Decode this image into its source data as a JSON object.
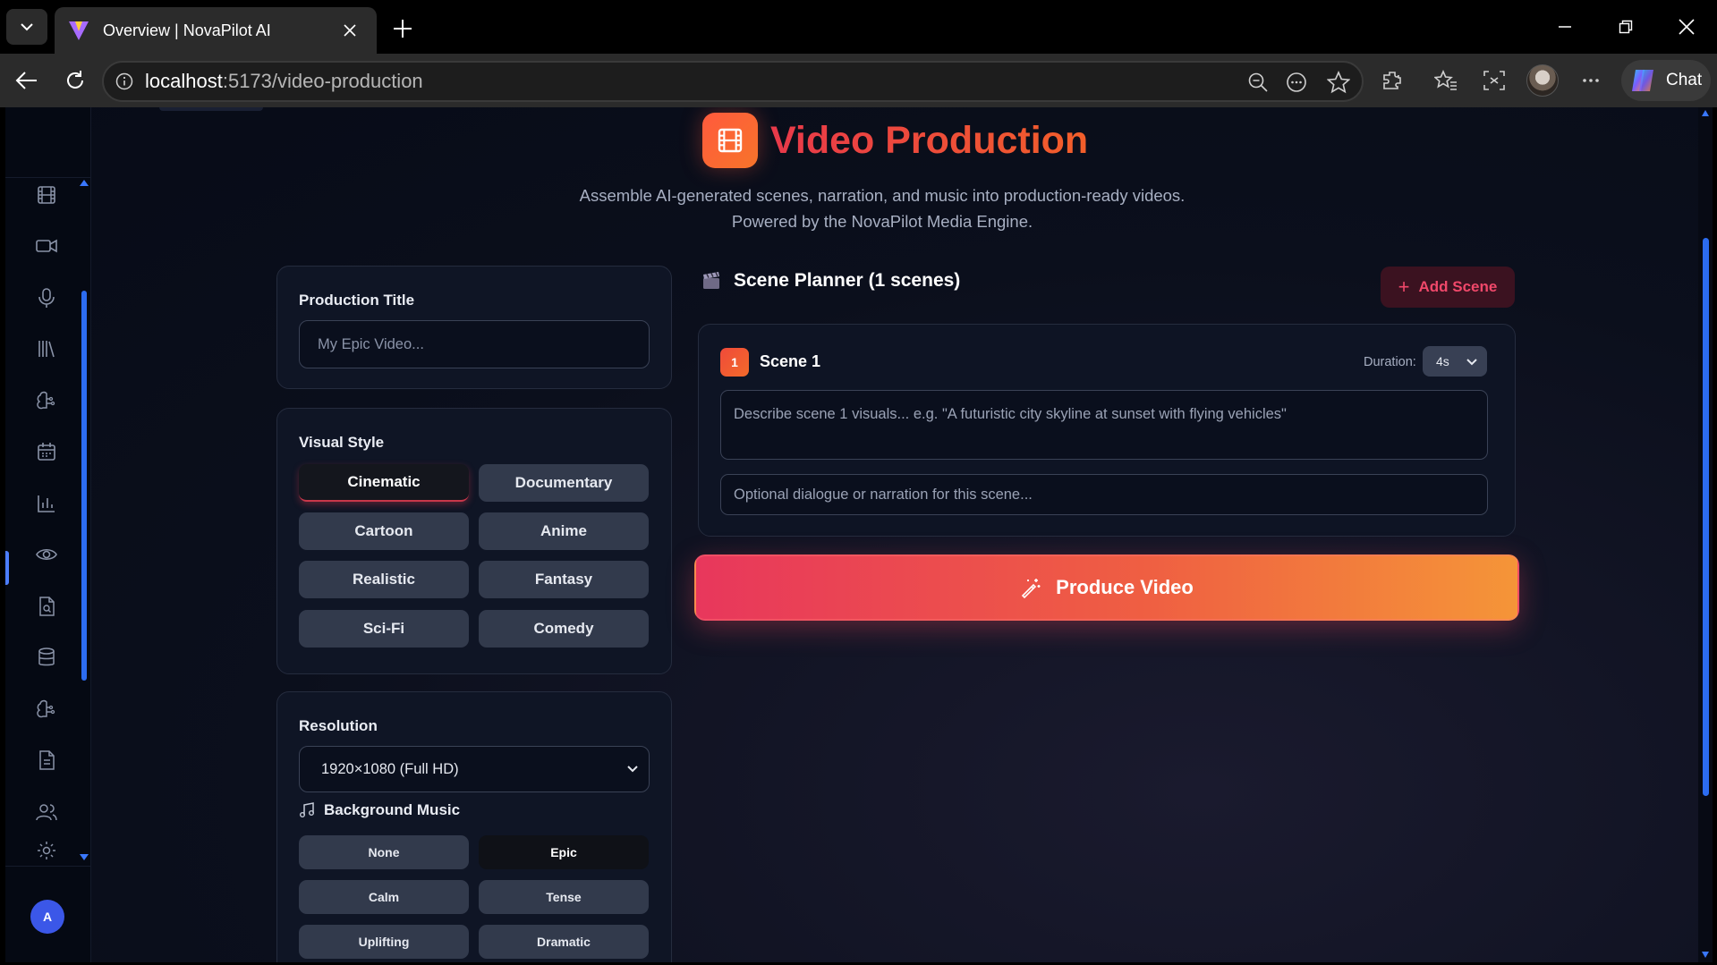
{
  "browser": {
    "tab_title": "Overview | NovaPilot AI",
    "url_host": "localhost",
    "url_path": ":5173/video-production",
    "chat_label": "Chat"
  },
  "header": {
    "title": "Video Production",
    "subtitle": "Assemble AI-generated scenes, narration, and music into production-ready videos. Powered by the NovaPilot Media Engine."
  },
  "production_title": {
    "label": "Production Title",
    "placeholder": "My Epic Video..."
  },
  "visual_style": {
    "label": "Visual Style",
    "selected": "Cinematic",
    "options": [
      "Cinematic",
      "Documentary",
      "Cartoon",
      "Anime",
      "Realistic",
      "Fantasy",
      "Sci-Fi",
      "Comedy"
    ]
  },
  "resolution": {
    "label": "Resolution",
    "value": "1920×1080 (Full HD)"
  },
  "music": {
    "label": "Background Music",
    "selected": "Epic",
    "options": [
      "None",
      "Epic",
      "Calm",
      "Tense",
      "Uplifting",
      "Dramatic"
    ]
  },
  "planner": {
    "title": "Scene Planner (1 scenes)",
    "add_label": "Add Scene",
    "scenes": [
      {
        "number": "1",
        "title": "Scene 1",
        "duration_label": "Duration:",
        "duration": "4s",
        "desc_placeholder": "Describe scene 1 visuals... e.g. \"A futuristic city skyline at sunset with flying vehicles\"",
        "dialog_placeholder": "Optional dialogue or narration for this scene..."
      }
    ]
  },
  "produce_label": "Produce Video",
  "user_initial": "A",
  "sidebar_icons": [
    "film-icon",
    "video-icon",
    "mic-icon",
    "library-icon",
    "brain-icon",
    "calendar-icon",
    "chart-icon",
    "eye-icon",
    "file-search-icon",
    "database-icon",
    "brain-icon-2",
    "document-icon",
    "users-icon",
    "settings-icon"
  ],
  "colors": {
    "accent_red": "#e8394a",
    "accent_orange": "#f59538",
    "sidebar_accent": "#2c6cf0",
    "background": "#0b0f1c"
  }
}
